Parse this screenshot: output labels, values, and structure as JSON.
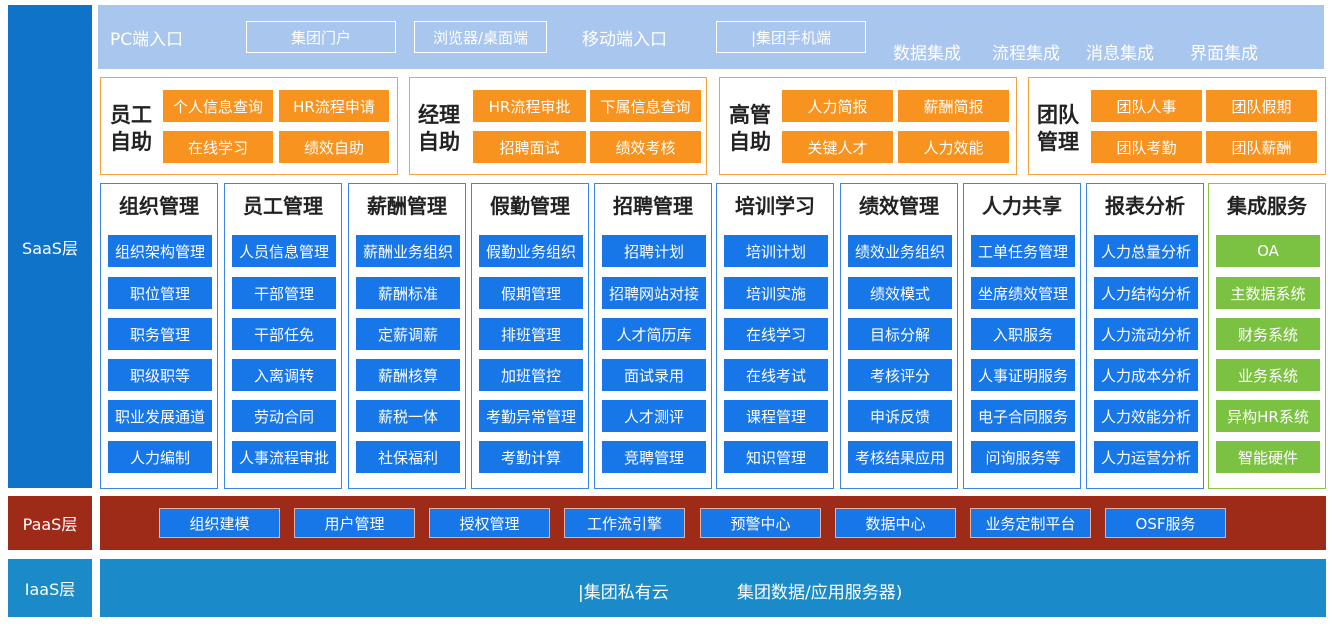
{
  "layers": {
    "saas": "SaaS层",
    "paas": "PaaS层",
    "iaas": "IaaS层"
  },
  "colors": {
    "saas_label": "#0f74c9",
    "paas_label": "#9e2a18",
    "iaas_label": "#1a8ac8",
    "entry_bar": "#a9c6ee",
    "self_service": "#f7931e",
    "module": "#1776e8",
    "integration": "#7cc242"
  },
  "entry": {
    "pc": "PC端入口",
    "pc_box1": "集团门户",
    "pc_box2": "浏览器/桌面端",
    "mobile": "移动端入口",
    "mobile_box": "|集团手机端",
    "integrations": [
      "数据集成",
      "流程集成",
      "消息集成",
      "界面集成"
    ]
  },
  "self_service": [
    {
      "title": "员工自助",
      "items": [
        "个人信息查询",
        "HR流程申请",
        "在线学习",
        "绩效自助"
      ]
    },
    {
      "title": "经理自助",
      "items": [
        "HR流程审批",
        "下属信息查询",
        "招聘面试",
        "绩效考核"
      ]
    },
    {
      "title": "高管自助",
      "items": [
        "人力简报",
        "薪酬简报",
        "关键人才",
        "人力效能"
      ]
    },
    {
      "title": "团队管理",
      "items": [
        "团队人事",
        "团队假期",
        "团队考勤",
        "团队薪酬"
      ]
    }
  ],
  "modules": [
    {
      "title": "组织管理",
      "items": [
        "组织架构管理",
        "职位管理",
        "职务管理",
        "职级职等",
        "职业发展通道",
        "人力编制"
      ]
    },
    {
      "title": "员工管理",
      "items": [
        "人员信息管理",
        "干部管理",
        "干部任免",
        "入离调转",
        "劳动合同",
        "人事流程审批"
      ]
    },
    {
      "title": "薪酬管理",
      "items": [
        "薪酬业务组织",
        "薪酬标准",
        "定薪调薪",
        "薪酬核算",
        "薪税一体",
        "社保福利"
      ]
    },
    {
      "title": "假勤管理",
      "items": [
        "假勤业务组织",
        "假期管理",
        "排班管理",
        "加班管控",
        "考勤异常管理",
        "考勤计算"
      ]
    },
    {
      "title": "招聘管理",
      "items": [
        "招聘计划",
        "招聘网站对接",
        "人才简历库",
        "面试录用",
        "人才测评",
        "竞聘管理"
      ]
    },
    {
      "title": "培训学习",
      "items": [
        "培训计划",
        "培训实施",
        "在线学习",
        "在线考试",
        "课程管理",
        "知识管理"
      ]
    },
    {
      "title": "绩效管理",
      "items": [
        "绩效业务组织",
        "绩效模式",
        "目标分解",
        "考核评分",
        "申诉反馈",
        "考核结果应用"
      ]
    },
    {
      "title": "人力共享",
      "items": [
        "工单任务管理",
        "坐席绩效管理",
        "入职服务",
        "人事证明服务",
        "电子合同服务",
        "问询服务等"
      ]
    },
    {
      "title": "报表分析",
      "items": [
        "人力总量分析",
        "人力结构分析",
        "人力流动分析",
        "人力成本分析",
        "人力效能分析",
        "人力运营分析"
      ]
    },
    {
      "title": "集成服务",
      "items": [
        "OA",
        "主数据系统",
        "财务系统",
        "业务系统",
        "异构HR系统",
        "智能硬件"
      ]
    }
  ],
  "paas": [
    "组织建模",
    "用户管理",
    "授权管理",
    "工作流引擎",
    "预警中心",
    "数据中心",
    "业务定制平台",
    "OSF服务"
  ],
  "iaas": {
    "left": "|集团私有云",
    "right": "集团数据/应用服务器)"
  }
}
